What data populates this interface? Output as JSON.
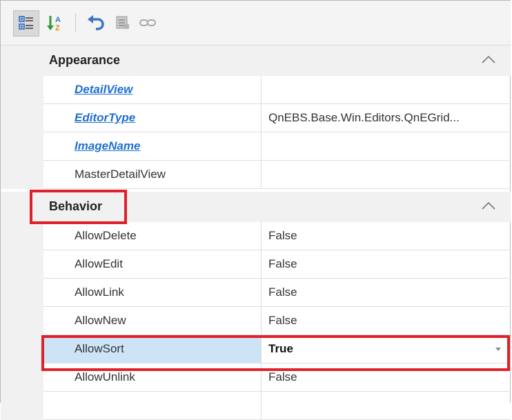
{
  "toolbar": {
    "buttons": [
      {
        "name": "categorized-view-icon"
      },
      {
        "name": "alphabetical-sort-icon"
      },
      {
        "name": "undo-icon"
      },
      {
        "name": "property-pages-icon"
      },
      {
        "name": "link-icon"
      }
    ]
  },
  "categories": [
    {
      "label": "Appearance",
      "rows": [
        {
          "name": "DetailView",
          "value": "",
          "link": true
        },
        {
          "name": "EditorType",
          "value": "QnEBS.Base.Win.Editors.QnEGrid...",
          "link": true
        },
        {
          "name": "ImageName",
          "value": "",
          "link": true
        },
        {
          "name": "MasterDetailView",
          "value": "",
          "link": false
        }
      ]
    },
    {
      "label": "Behavior",
      "rows": [
        {
          "name": "AllowDelete",
          "value": "False"
        },
        {
          "name": "AllowEdit",
          "value": "False"
        },
        {
          "name": "AllowLink",
          "value": "False"
        },
        {
          "name": "AllowNew",
          "value": "False"
        },
        {
          "name": "AllowSort",
          "value": "True",
          "selected": true
        },
        {
          "name": "AllowUnlink",
          "value": "False"
        }
      ]
    }
  ],
  "colors": {
    "highlight": "#e0202a",
    "link": "#1f6fd1",
    "selected_row": "#cde4f7"
  }
}
